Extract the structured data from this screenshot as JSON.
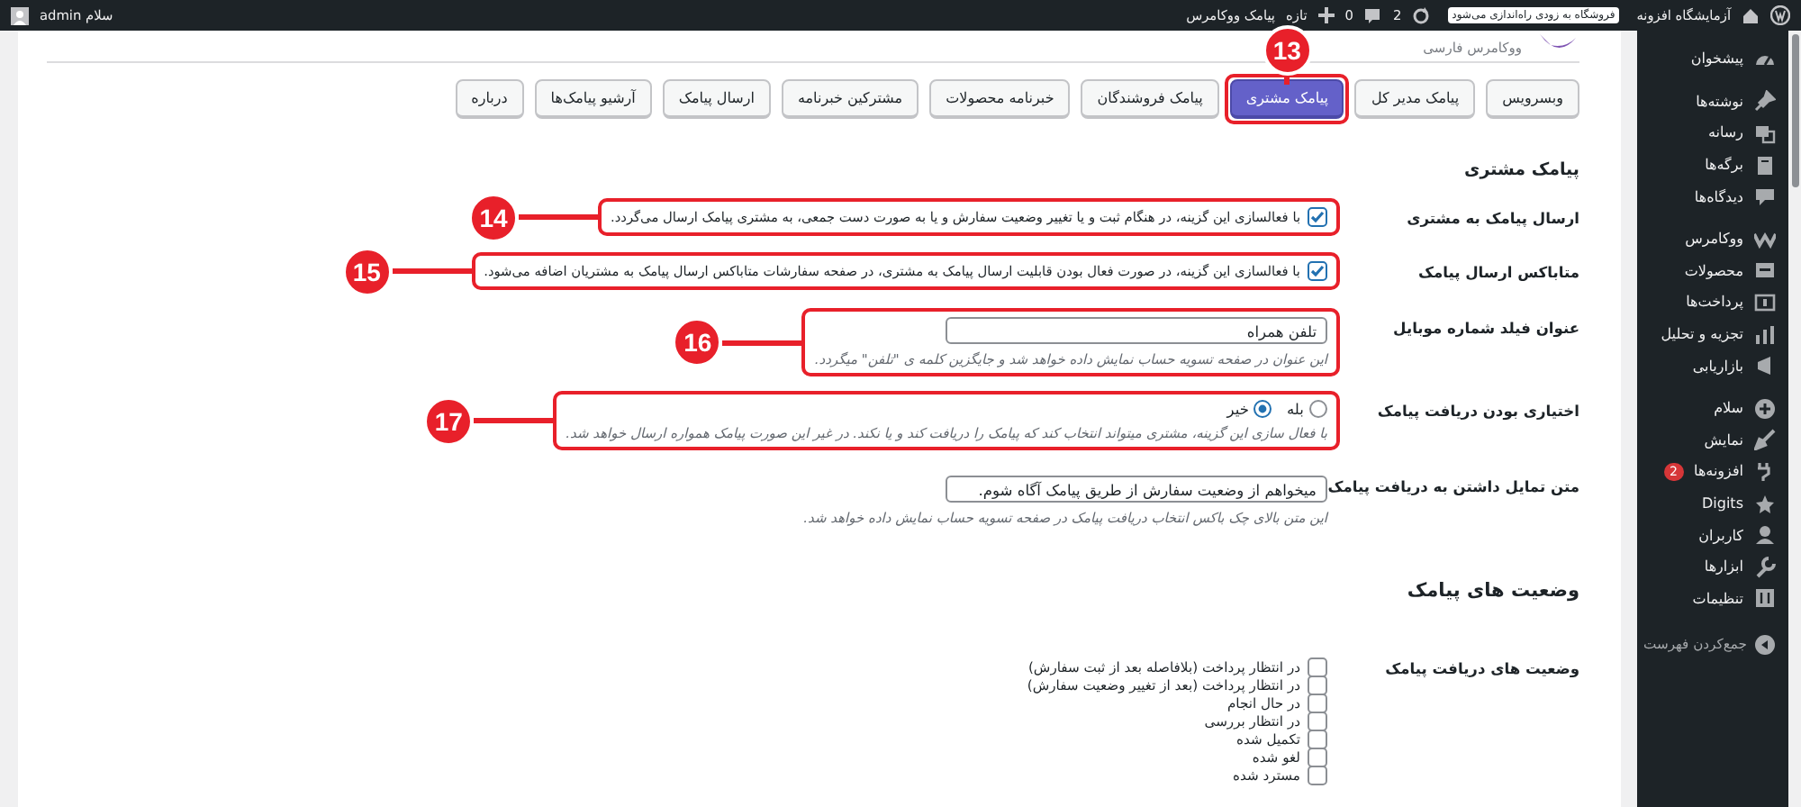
{
  "admin_bar": {
    "site_name": "آزمایشگاه افزونه",
    "notice": "فروشگاه به زودی راه‌اندازی می‌شود",
    "updates": "2",
    "comments": "0",
    "new_label": "تازه",
    "plugin_link": "پیامک ووکامرس",
    "greeting": "سلام admin"
  },
  "sidebar": {
    "groups": [
      [
        {
          "label": "پیشخوان",
          "selected": false
        }
      ],
      [
        {
          "label": "نوشته‌ها",
          "selected": false
        },
        {
          "label": "رسانه",
          "selected": false
        },
        {
          "label": "برگه‌ها",
          "selected": false
        },
        {
          "label": "دیدگاه‌ها",
          "selected": false
        }
      ],
      [
        {
          "label": "ووکامرس",
          "selected": false
        },
        {
          "label": "محصولات",
          "selected": false
        },
        {
          "label": "پرداخت‌ها",
          "selected": false
        },
        {
          "label": "تجزیه و تحلیل",
          "selected": false
        },
        {
          "label": "بازاریابی",
          "selected": false
        }
      ],
      [
        {
          "label": "سلام",
          "selected": false
        },
        {
          "label": "نمایش",
          "selected": false
        },
        {
          "label": "افزونه‌ها",
          "selected": false,
          "badge": "2"
        },
        {
          "label": "Digits",
          "selected": false
        },
        {
          "label": "کاربران",
          "selected": false
        },
        {
          "label": "ابزارها",
          "selected": false
        },
        {
          "label": "تنظیمات",
          "selected": false
        }
      ]
    ],
    "collapse": "جمع‌کردن فهرست"
  },
  "plugin_logo": {
    "text": "ووکامرس فارسی"
  },
  "tabs": [
    {
      "label": "وبسرویس",
      "selected": false
    },
    {
      "label": "پیامک مدیر کل",
      "selected": false
    },
    {
      "label": "پیامک مشتری",
      "selected": true
    },
    {
      "label": "پیامک فروشندگان",
      "selected": false
    },
    {
      "label": "خبرنامه محصولات",
      "selected": false
    },
    {
      "label": "مشترکین خبرنامه",
      "selected": false
    },
    {
      "label": "ارسال پیامک",
      "selected": false
    },
    {
      "label": "آرشیو پیامک‌ها",
      "selected": false
    },
    {
      "label": "درباره",
      "selected": false
    }
  ],
  "section_title": "پیامک مشتری",
  "fields": [
    {
      "kind": "checkbox",
      "label": "ارسال پیامک به مشتری",
      "checked": true,
      "text": "با فعالسازی این گزینه، در هنگام ثبت و یا تغییر وضعیت سفارش و یا به صورت دست جمعی، به مشتری پیامک ارسال می‌گردد."
    },
    {
      "kind": "checkbox",
      "label": "متاباکس ارسال پیامک",
      "checked": true,
      "text": "با فعالسازی این گزینه، در صورت فعال بودن قابلیت ارسال پیامک به مشتری، در صفحه سفارشات متاباکس ارسال پیامک به مشتریان اضافه می‌شود."
    },
    {
      "kind": "text",
      "label": "عنوان فیلد شماره موبایل",
      "value": "تلفن همراه",
      "description": "این عنوان در صفحه تسویه حساب نمایش داده خواهد شد و جایگزین کلمه ی \"تلفن\" میگردد."
    },
    {
      "kind": "radio",
      "label": "اختیاری بودن دریافت پیامک",
      "options": [
        {
          "label": "بله",
          "selected": false
        },
        {
          "label": "خیر",
          "selected": true
        }
      ],
      "description": "با فعال سازی این گزینه، مشتری میتواند انتخاب کند که پیامک را دریافت کند و یا نکند. در غیر این صورت پیامک همواره ارسال خواهد شد."
    },
    {
      "kind": "text",
      "label": "متن تمایل داشتن به دریافت پیامک",
      "value": "میخواهم از وضعیت سفارش از طریق پیامک آگاه شوم.",
      "description": "این متن بالای چک باکس انتخاب دریافت پیامک در صفحه تسویه حساب نمایش داده خواهد شد."
    }
  ],
  "status_section": {
    "title": "وضعیت های پیامک",
    "label": "وضعیت های دریافت پیامک",
    "options": [
      {
        "label": "در انتظار پرداخت (بلافاصله بعد از ثبت سفارش)",
        "checked": false
      },
      {
        "label": "در انتظار پرداخت (بعد از تغییر وضعیت سفارش)",
        "checked": false
      },
      {
        "label": "در حال انجام",
        "checked": false
      },
      {
        "label": "در انتظار بررسی",
        "checked": false
      },
      {
        "label": "تکمیل شده",
        "checked": false
      },
      {
        "label": "لغو شده",
        "checked": false
      },
      {
        "label": "مسترد شده",
        "checked": false
      }
    ]
  },
  "annotations": [
    {
      "number": "13"
    },
    {
      "number": "14"
    },
    {
      "number": "15"
    },
    {
      "number": "16"
    },
    {
      "number": "17"
    }
  ]
}
